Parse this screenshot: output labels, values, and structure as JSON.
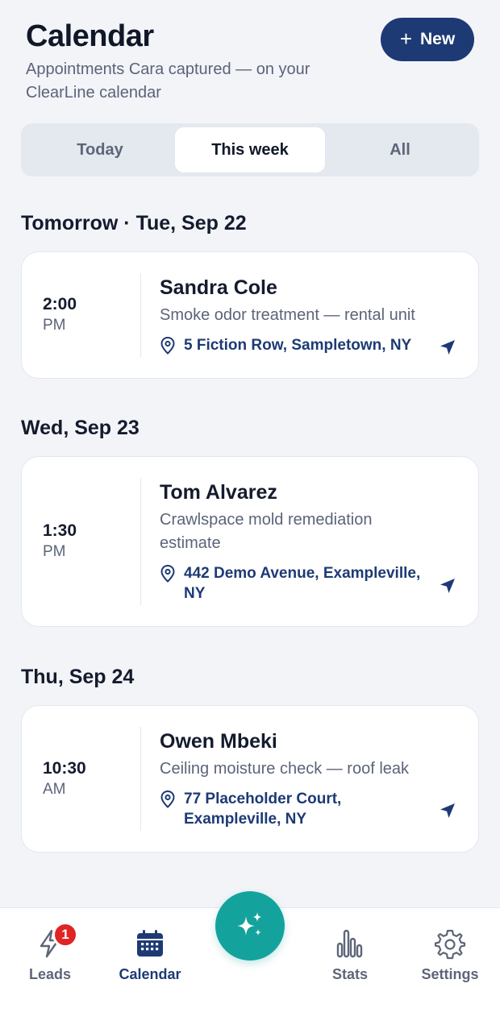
{
  "header": {
    "title": "Calendar",
    "subtitle": "Appointments Cara captured — on your ClearLine calendar",
    "new_button": {
      "icon": "plus-icon",
      "label": "New"
    }
  },
  "tabs": [
    {
      "label": "Today",
      "active": false
    },
    {
      "label": "This week",
      "active": true
    },
    {
      "label": "All",
      "active": false
    }
  ],
  "days": [
    {
      "heading": "Tomorrow · Tue, Sep 22",
      "appointment": {
        "time": "2:00",
        "ampm": "PM",
        "name": "Sandra Cole",
        "description": "Smoke odor treatment — rental unit",
        "address": "5 Fiction Row, Sampletown, NY"
      }
    },
    {
      "heading": "Wed, Sep 23",
      "appointment": {
        "time": "1:30",
        "ampm": "PM",
        "name": "Tom Alvarez",
        "description": "Crawlspace mold remediation estimate",
        "address": "442 Demo Avenue, Exampleville, NY"
      }
    },
    {
      "heading": "Thu, Sep 24",
      "appointment": {
        "time": "10:30",
        "ampm": "AM",
        "name": "Owen Mbeki",
        "description": "Ceiling moisture check — roof leak",
        "address": "77 Placeholder Court, Exampleville, NY"
      }
    }
  ],
  "bottom_nav": {
    "items": [
      {
        "label": "Leads",
        "icon": "lightning-icon",
        "badge": "1"
      },
      {
        "label": "Calendar",
        "icon": "calendar-icon",
        "active": true
      },
      {
        "label": "Stats",
        "icon": "bar-chart-icon"
      },
      {
        "label": "Settings",
        "icon": "gear-icon"
      }
    ],
    "fab_icon": "sparkles-icon"
  },
  "colors": {
    "background": "#f2f4f8",
    "primary": "#1d3a75",
    "accent": "#14a39c",
    "badge": "#e02424",
    "muted_text": "#5b6478"
  }
}
